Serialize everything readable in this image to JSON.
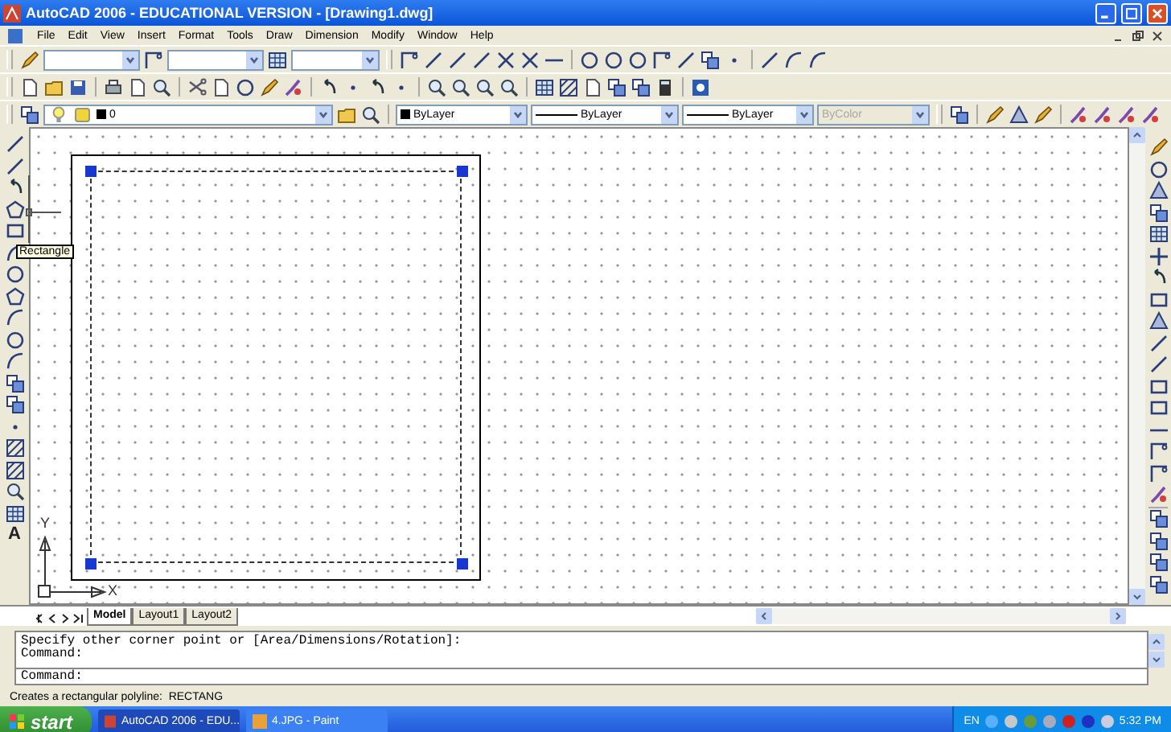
{
  "window": {
    "title": "AutoCAD 2006 - EDUCATIONAL VERSION - [Drawing1.dwg]"
  },
  "menu": [
    "File",
    "Edit",
    "View",
    "Insert",
    "Format",
    "Tools",
    "Draw",
    "Dimension",
    "Modify",
    "Window",
    "Help"
  ],
  "properties_toolbar": {
    "layer": "0",
    "color_control": "ByLayer",
    "linetype": "ByLayer",
    "lineweight": "ByLayer",
    "plot_style": {
      "value": "ByColor",
      "disabled": true
    }
  },
  "draw_toolbar": {
    "text_tool": "A"
  },
  "tooltip": "Rectangle",
  "ucs": {
    "y_label": "Y",
    "x_label": "X"
  },
  "layout_tabs": [
    {
      "label": "Model",
      "selected": true
    },
    {
      "label": "Layout1",
      "selected": false
    },
    {
      "label": "Layout2",
      "selected": false
    }
  ],
  "command_window": {
    "history": [
      "Specify other corner point or [Area/Dimensions/Rotation]:",
      "Command:"
    ],
    "prompt": "Command:"
  },
  "status_bar": "Creates a rectangular polyline:  RECTANG",
  "taskbar": {
    "start": "start",
    "tasks": [
      {
        "label": "AutoCAD 2006 - EDU...",
        "selected": true
      },
      {
        "label": "4.JPG - Paint",
        "selected": false
      }
    ],
    "language": "EN",
    "clock": "5:32 PM"
  }
}
